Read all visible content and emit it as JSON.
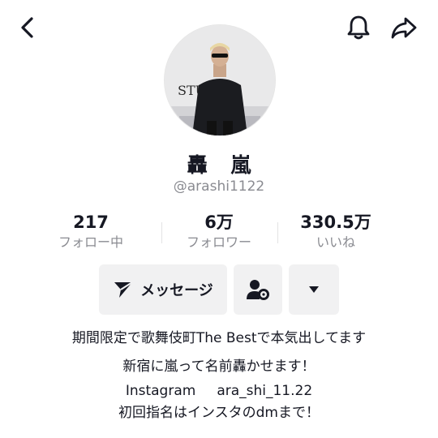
{
  "header": {
    "back_icon": "chevron-left-icon",
    "notification_icon": "bell-icon",
    "share_icon": "share-arrow-icon"
  },
  "profile": {
    "display_name": "轟 嵐",
    "username": "@arashi1122",
    "avatar_sign_text": "STU   S"
  },
  "stats": [
    {
      "value": "217",
      "label": "フォロー中"
    },
    {
      "value": "6万",
      "label": "フォロワー"
    },
    {
      "value": "330.5万",
      "label": "いいね"
    }
  ],
  "actions": {
    "message_label": "メッセージ",
    "message_icon": "send-icon",
    "friend_icon": "person-gear-icon",
    "more_icon": "caret-down-icon"
  },
  "bio": {
    "line1": "期間限定で歌舞伎町The Bestで本気出してます",
    "line2": "新宿に嵐って名前轟かせます！",
    "line3_label": "Instagram",
    "line3_handle": "ara_shi_11.22",
    "line4": "初回指名はインスタのdmまで！"
  },
  "colors": {
    "text": "#161823",
    "secondary_text": "#8a8b91",
    "button_bg": "#f1f1f2"
  }
}
